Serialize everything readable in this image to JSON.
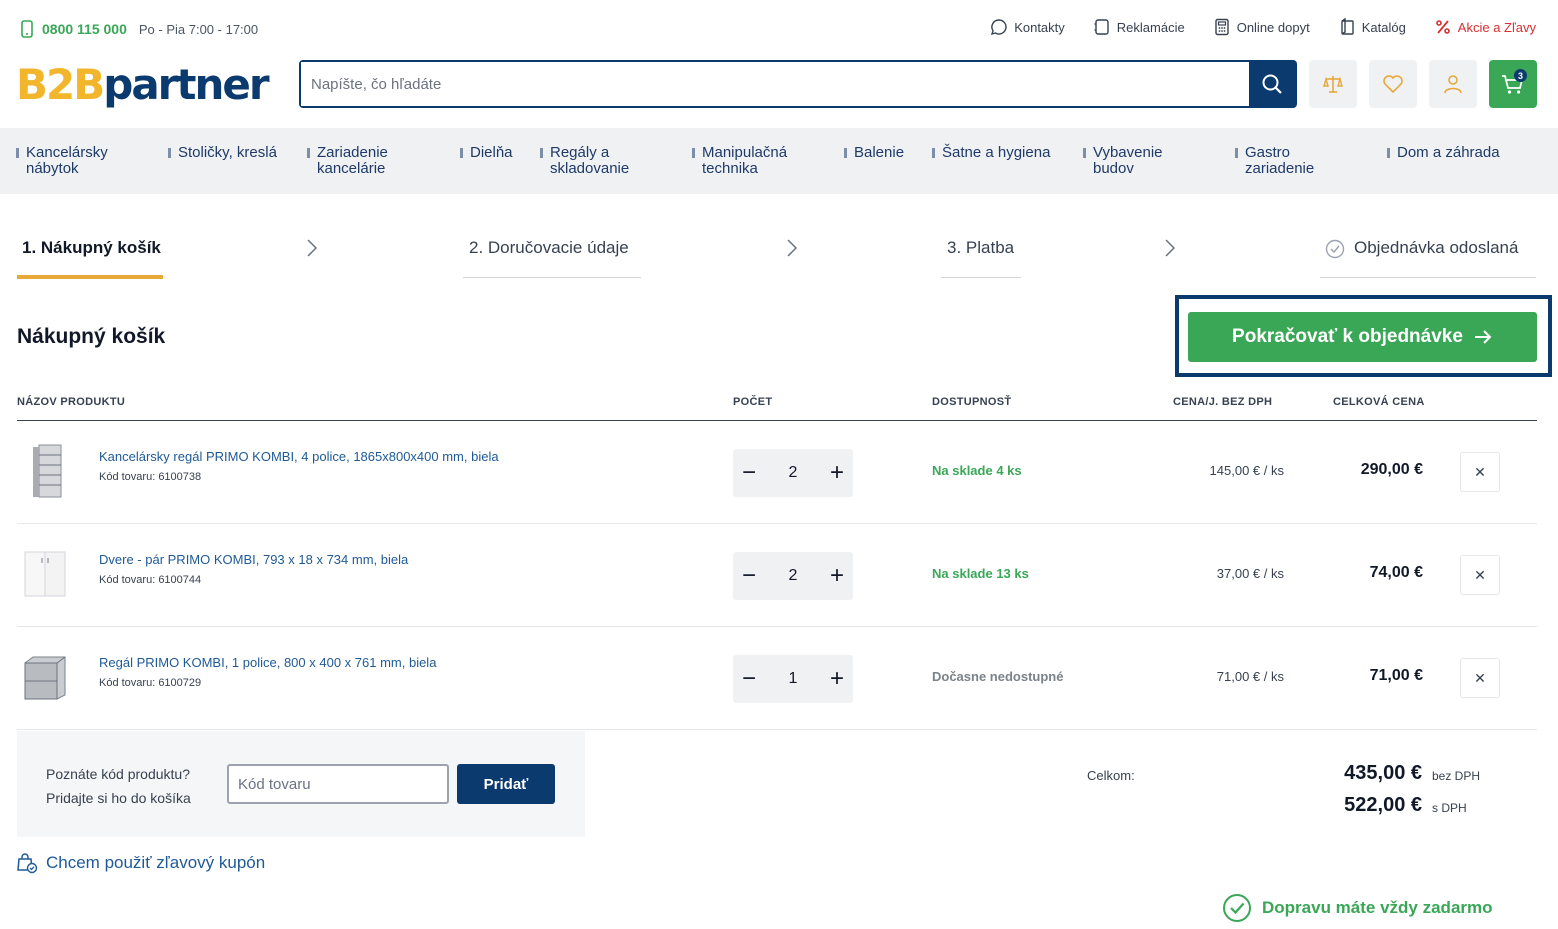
{
  "topbar": {
    "phone": "0800 115 000",
    "hours": "Po - Pia 7:00 - 17:00",
    "links": [
      {
        "label": "Kontakty",
        "icon": "chat-icon"
      },
      {
        "label": "Reklamácie",
        "icon": "notebook-icon"
      },
      {
        "label": "Online dopyt",
        "icon": "calculator-icon"
      },
      {
        "label": "Katalóg",
        "icon": "catalog-icon"
      },
      {
        "label": "Akcie a Zľavy",
        "icon": "percent-icon"
      }
    ]
  },
  "header": {
    "logo_part1": "B2B",
    "logo_part2": "partner",
    "search_placeholder": "Napíšte, čo hľadáte",
    "cart_count": "3"
  },
  "nav": {
    "items": [
      "Kancelársky nábytok",
      "Stoličky, kreslá",
      "Zariadenie kancelárie",
      "Dielňa",
      "Regály a skladovanie",
      "Manipulačná technika",
      "Balenie",
      "Šatne a hygiena",
      "Vybavenie budov",
      "Gastro zariadenie",
      "Dom a záhrada"
    ]
  },
  "steps": [
    "1. Nákupný košík",
    "2. Doručovacie údaje",
    "3. Platba",
    "Objednávka odoslaná"
  ],
  "cart": {
    "title": "Nákupný košík",
    "continue_label": "Pokračovať k objednávke",
    "columns": [
      "NÁZOV PRODUKTU",
      "POČET",
      "DOSTUPNOSŤ",
      "CENA/J. BEZ DPH",
      "CELKOVÁ CENA"
    ],
    "items": [
      {
        "name": "Kancelársky regál PRIMO KOMBI, 4 police, 1865x800x400 mm, biela",
        "code": "Kód tovaru: 6100738",
        "qty": "2",
        "availability": "Na sklade 4 ks",
        "unit_price": "145,00 € / ks",
        "total": "290,00 €"
      },
      {
        "name": "Dvere - pár PRIMO KOMBI, 793 x 18 x 734 mm, biela",
        "code": "Kód tovaru: 6100744",
        "qty": "2",
        "availability": "Na sklade 13 ks",
        "unit_price": "37,00 € / ks",
        "total": "74,00 €"
      },
      {
        "name": "Regál PRIMO KOMBI, 1 police, 800 x 400 x 761 mm, biela",
        "code": "Kód tovaru: 6100729",
        "qty": "1",
        "availability": "Dočasne nedostupné",
        "unit_price": "71,00 € / ks",
        "total": "71,00 €"
      }
    ],
    "code_label_line1": "Poznáte kód produktu?",
    "code_label_line2": "Pridajte si ho do košíka",
    "code_placeholder": "Kód tovaru",
    "code_button": "Pridať",
    "coupon": "Chcem použiť zľavový kupón",
    "sum_label": "Celkom:",
    "sum_net": "435,00 €",
    "sum_net_note": "bez DPH",
    "sum_gross": "522,00 €",
    "sum_gross_note": "s DPH",
    "free_shipping": "Dopravu máte vždy zadarmo"
  },
  "colors": {
    "brand_blue": "#0b3a6e",
    "brand_green": "#3aa757",
    "brand_yellow": "#f2b62c",
    "sale_red": "#d63030"
  }
}
